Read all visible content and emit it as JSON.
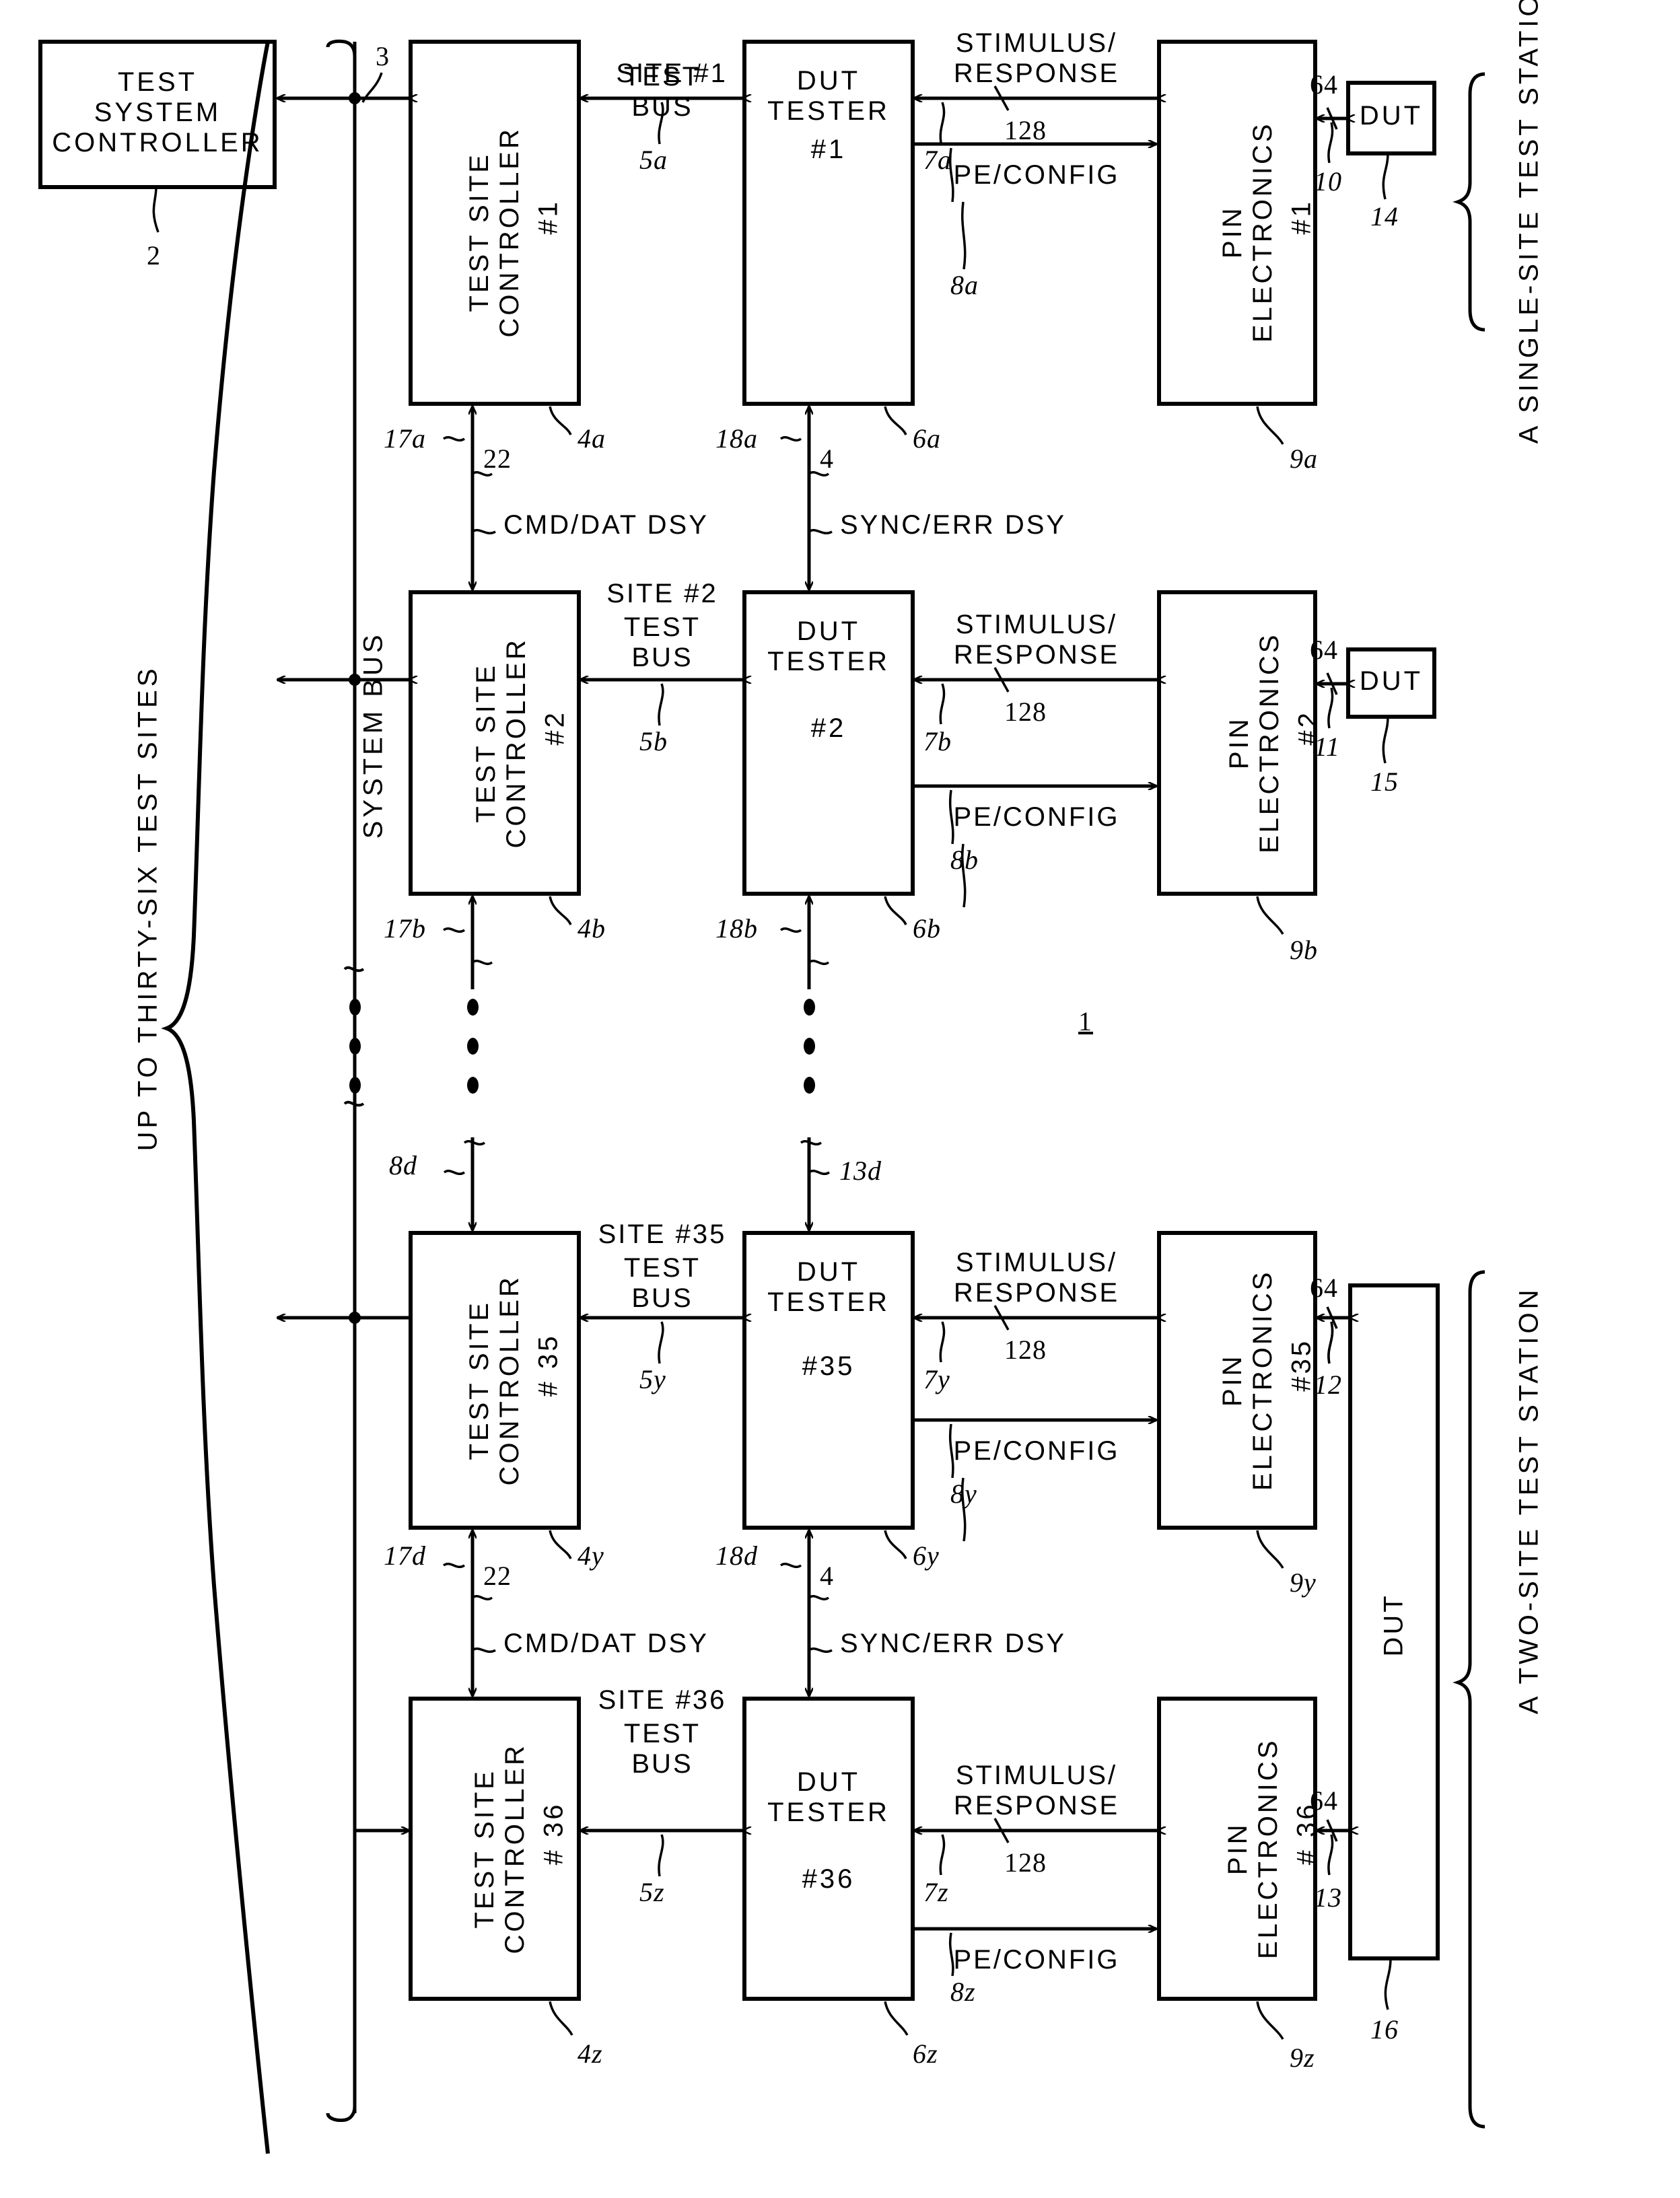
{
  "figure": {
    "number": "1"
  },
  "system": {
    "test_system_controller": "TEST\nSYSTEM\nCONTROLLER",
    "test_system_controller_ref": "2",
    "system_bus_label": "SYSTEM BUS",
    "system_bus_ref": "3",
    "up_to_sites_label": "UP TO THIRTY-SIX TEST SITES"
  },
  "stations": {
    "single_site": "A SINGLE-SITE TEST STATION",
    "two_site": "A TWO-SITE TEST STATION"
  },
  "common": {
    "test_site_controller": "TEST SITE\nCONTROLLER",
    "dut_tester": "DUT\nTESTER",
    "pin_electronics": "PIN\nELECTRONICS",
    "dut": "DUT",
    "test_bus_suffix": "TEST\nBUS",
    "stimulus_response": "STIMULUS/\nRESPONSE",
    "stimulus_width": "128",
    "pe_config": "PE/CONFIG",
    "dut_width": "64",
    "cmd_dat_dsy": "CMD/DAT DSY",
    "sync_err_dsy": "SYNC/ERR DSY",
    "cmd_dat_ref": "22",
    "sync_err_ref": "4"
  },
  "rows": [
    {
      "site_label": "SITE #1",
      "controller_num": "#1",
      "tester_num": "#1",
      "pe_num": "#1",
      "test_bus_ref": "5a",
      "stimulus_ref": "7a",
      "pe_config_ref": "8a",
      "controller_ref": "4a",
      "tester_ref": "6a",
      "pe_ref": "9a",
      "dut_link_ref": "10",
      "dut_ref": "14",
      "cmd_in_ref": "17a",
      "sync_in_ref": "18a",
      "has_dut_box": true
    },
    {
      "site_label": "SITE #2",
      "controller_num": "#2",
      "tester_num": "#2",
      "pe_num": "#2",
      "test_bus_ref": "5b",
      "stimulus_ref": "7b",
      "pe_config_ref": "8b",
      "controller_ref": "4b",
      "tester_ref": "6b",
      "pe_ref": "9b",
      "dut_link_ref": "11",
      "dut_ref": "15",
      "cmd_in_ref": "17b",
      "sync_in_ref": "18b",
      "has_dut_box": true
    },
    {
      "site_label": "SITE #35",
      "controller_num": "# 35",
      "tester_num": "#35",
      "pe_num": "#35",
      "test_bus_ref": "5y",
      "stimulus_ref": "7y",
      "pe_config_ref": "8y",
      "controller_ref": "4y",
      "tester_ref": "6y",
      "pe_ref": "9y",
      "dut_link_ref": "12",
      "dut_ref": "",
      "cmd_in_ref": "17d",
      "sync_in_ref": "18d",
      "has_dut_box": false
    },
    {
      "site_label": "SITE #36",
      "controller_num": "# 36",
      "tester_num": "#36",
      "pe_num": "# 36",
      "test_bus_ref": "5z",
      "stimulus_ref": "7z",
      "pe_config_ref": "8z",
      "controller_ref": "4z",
      "tester_ref": "6z",
      "pe_ref": "9z",
      "dut_link_ref": "13",
      "dut_ref": "16",
      "cmd_in_ref": "",
      "sync_in_ref": "",
      "has_dut_box": false
    }
  ],
  "ellipsis_refs": {
    "cmd_chain": "8d",
    "sync_chain": "13d"
  },
  "shared_dut": {
    "label": "DUT",
    "ref": "16"
  }
}
